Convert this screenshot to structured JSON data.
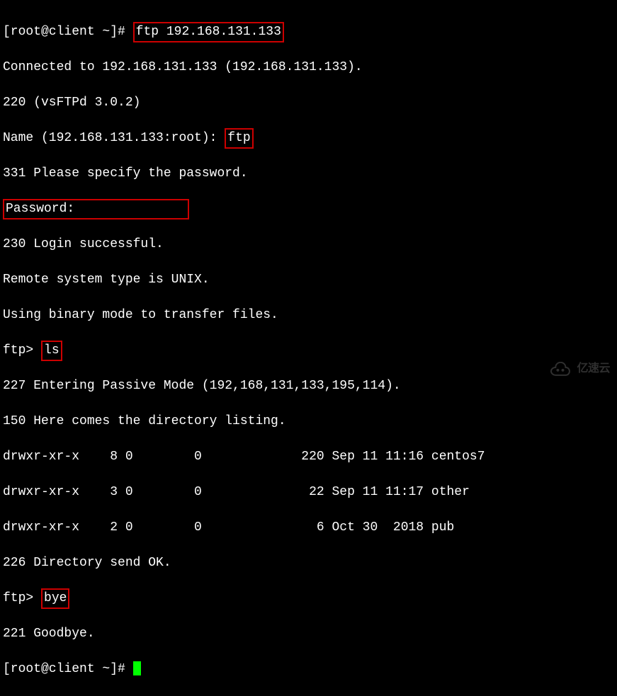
{
  "prompt1_prefix": "[root@client ~]# ",
  "cmd_ftp": "ftp 192.168.131.133",
  "line_connected": "Connected to 192.168.131.133 (192.168.131.133).",
  "line_220": "220 (vsFTPd 3.0.2)",
  "name_prompt": "Name (192.168.131.133:root): ",
  "name_input": "ftp",
  "line_331": "331 Please specify the password.",
  "password_prompt": "Password:",
  "line_230": "230 Login successful.",
  "line_remote": "Remote system type is UNIX.",
  "line_binary": "Using binary mode to transfer files.",
  "ftp_prompt1_prefix": "ftp> ",
  "cmd_ls": "ls",
  "line_227": "227 Entering Passive Mode (192,168,131,133,195,114).",
  "line_150": "150 Here comes the directory listing.",
  "dir_entries": [
    "drwxr-xr-x    8 0        0             220 Sep 11 11:16 centos7",
    "drwxr-xr-x    3 0        0              22 Sep 11 11:17 other",
    "drwxr-xr-x    2 0        0               6 Oct 30  2018 pub"
  ],
  "line_226": "226 Directory send OK.",
  "ftp_prompt2_prefix": "ftp> ",
  "cmd_bye": "bye",
  "line_221": "221 Goodbye.",
  "prompt2_prefix": "[root@client ~]# ",
  "watermark_text": "亿速云"
}
